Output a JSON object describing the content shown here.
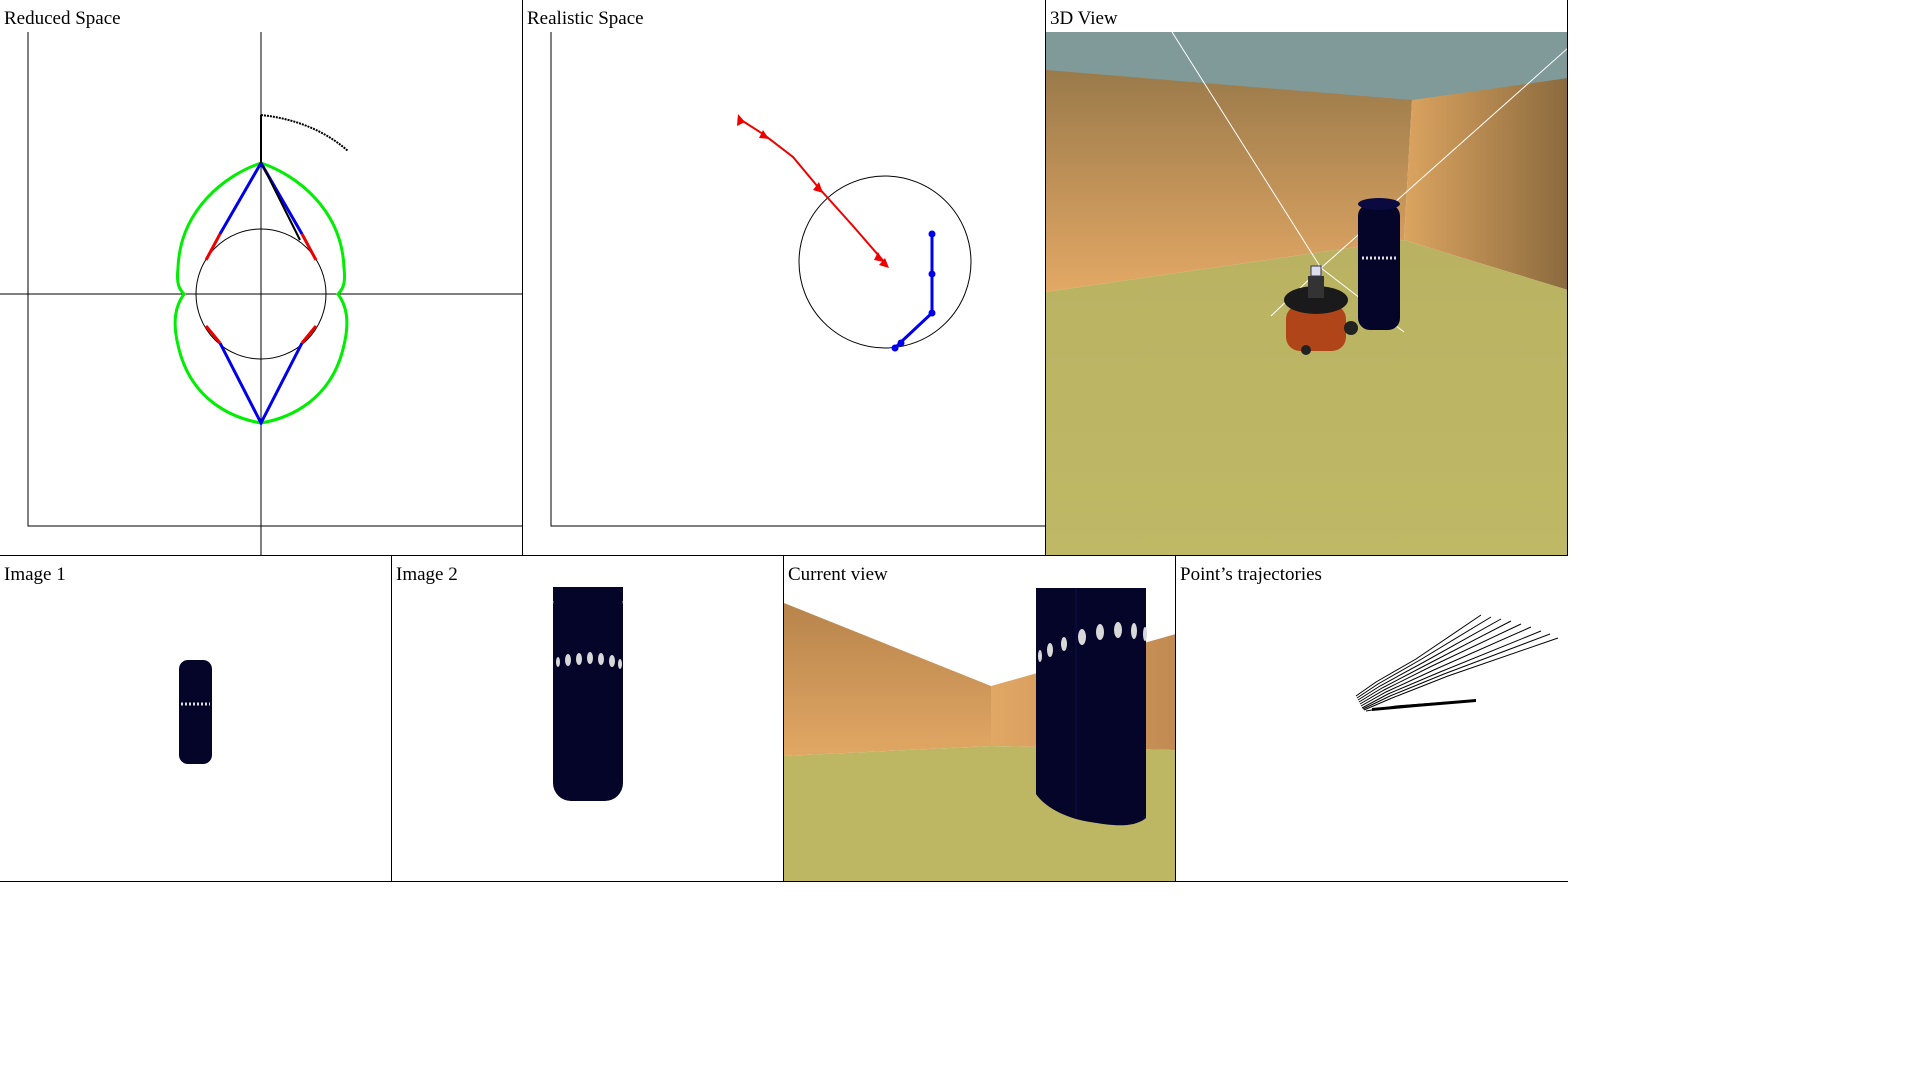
{
  "panels": {
    "reduced": {
      "title": "Reduced Space"
    },
    "realistic": {
      "title": "Realistic Space"
    },
    "view3d": {
      "title": "3D View"
    },
    "image1": {
      "title": "Image 1"
    },
    "image2": {
      "title": "Image 2"
    },
    "current": {
      "title": "Current view"
    },
    "trajectories": {
      "title": "Point’s trajectories"
    }
  },
  "colors": {
    "boundary": "#00ee00",
    "path": "#0000ee",
    "segment": "#ee0000",
    "target_path": "#ee0000",
    "robot_path": "#0000ee",
    "sky": "#7f9a98",
    "wall": "#d9a061",
    "floor": "#bdb764",
    "cylinder": "#05052a"
  }
}
